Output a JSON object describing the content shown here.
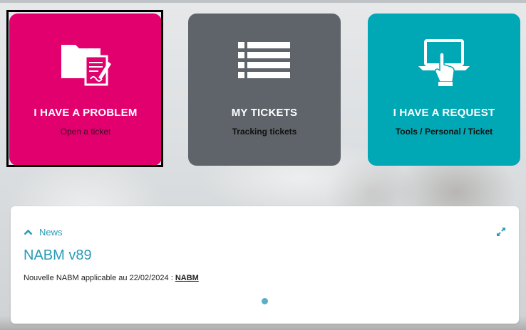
{
  "tiles": [
    {
      "title": "I HAVE A PROBLEM",
      "subtitle": "Open a ticket",
      "icon": "folder-document-icon",
      "color": "#e2006f"
    },
    {
      "title": "MY TICKETS",
      "subtitle": "Tracking tickets",
      "icon": "list-icon",
      "color": "#5f646a"
    },
    {
      "title": "I HAVE A REQUEST",
      "subtitle": "Tools / Personal / Ticket",
      "icon": "touch-screen-icon",
      "color": "#00a8b5"
    }
  ],
  "news": {
    "label": "News",
    "title": "NABM v89",
    "text": "Nouvelle NABM applicable au 22/02/2024 : ",
    "link": "NABM",
    "accent_color": "#2a9cb5",
    "icons": {
      "collapse": "chevron-up-icon",
      "expand": "expand-icon"
    }
  }
}
